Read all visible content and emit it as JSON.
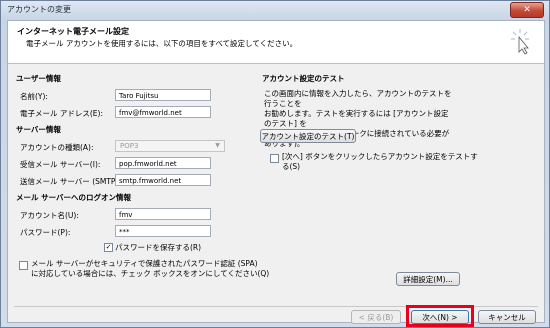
{
  "window": {
    "title": "アカウントの変更",
    "close_label": "✕"
  },
  "header": {
    "title": "インターネット電子メール設定",
    "subtitle": "電子メール アカウントを使用するには、以下の項目をすべて設定してください。",
    "cursor_icon": "click-cursor-icon"
  },
  "user_info": {
    "section": "ユーザー情報",
    "name_label": "名前(Y):",
    "name_value": "Taro Fujitsu",
    "email_label": "電子メール アドレス(E):",
    "email_value": "fmv@fmworld.net"
  },
  "server_info": {
    "section": "サーバー情報",
    "type_label": "アカウントの種類(A):",
    "type_value": "POP3",
    "incoming_label": "受信メール サーバー(I):",
    "incoming_value": "pop.fmworld.net",
    "outgoing_label": "送信メール サーバー (SMTP)(O):",
    "outgoing_value": "smtp.fmworld.net"
  },
  "logon_info": {
    "section": "メール サーバーへのログオン情報",
    "account_label": "アカウント名(U):",
    "account_value": "fmv",
    "password_label": "パスワード(P):",
    "password_value": "***",
    "save_password_label": "パスワードを保存する(R)",
    "save_password_checked": true,
    "spa_label_line1": "メール サーバーがセキュリティで保護されたパスワード認証 (SPA)",
    "spa_label_line2": "に対応している場合には、チェック ボックスをオンにしてください(Q)",
    "spa_checked": false
  },
  "test": {
    "section": "アカウント設定のテスト",
    "description_line1": "この画面内に情報を入力したら、アカウントのテストを行うことを",
    "description_line2": "お勧めします。テストを実行するには [アカウント設定のテスト] を",
    "description_line3": "クリックします (ネットワークに接続されている必要があります)。",
    "test_button": "アカウント設定のテスト(T)",
    "auto_test_line1": "[次へ] ボタンをクリックしたらアカウント設定をテストす",
    "auto_test_line2": "る(S)",
    "auto_test_checked": false
  },
  "buttons": {
    "details": "詳細設定(M)...",
    "back": "< 戻る(B)",
    "next": "次へ(N) >",
    "cancel": "キャンセル"
  },
  "colors": {
    "highlight_box": "#e8001c"
  }
}
